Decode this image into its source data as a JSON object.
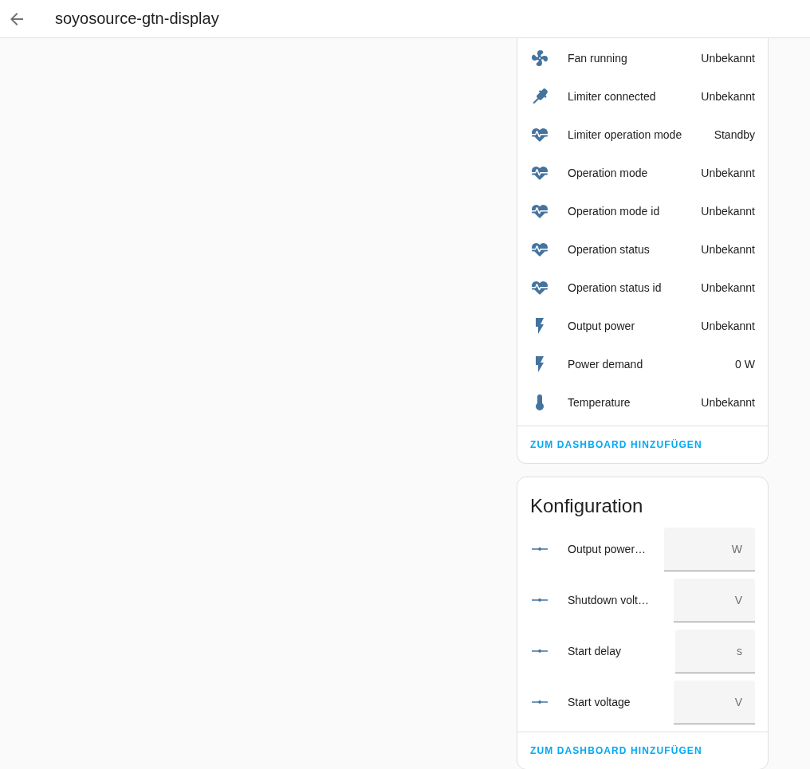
{
  "header": {
    "title": "soyosource-gtn-display"
  },
  "sensor_card": {
    "rows": [
      {
        "kind": "fan",
        "label": "Fan running",
        "value": "Unbekannt"
      },
      {
        "kind": "plug",
        "label": "Limiter connected",
        "value": "Unbekannt"
      },
      {
        "kind": "pulse",
        "label": "Limiter operation mode",
        "value": "Standby"
      },
      {
        "kind": "pulse",
        "label": "Operation mode",
        "value": "Unbekannt"
      },
      {
        "kind": "pulse",
        "label": "Operation mode id",
        "value": "Unbekannt"
      },
      {
        "kind": "pulse",
        "label": "Operation status",
        "value": "Unbekannt"
      },
      {
        "kind": "pulse",
        "label": "Operation status id",
        "value": "Unbekannt"
      },
      {
        "kind": "flash",
        "label": "Output power",
        "value": "Unbekannt"
      },
      {
        "kind": "flash",
        "label": "Power demand",
        "value": "0 W"
      },
      {
        "kind": "thermometer",
        "label": "Temperature",
        "value": "Unbekannt"
      }
    ],
    "action": "ZUM DASHBOARD HINZUFÜGEN"
  },
  "config_card": {
    "title": "Konfiguration",
    "rows": [
      {
        "label": "Output power…",
        "unit": "W"
      },
      {
        "label": "Shutdown volt…",
        "unit": "V"
      },
      {
        "label": "Start delay",
        "unit": "s"
      },
      {
        "label": "Start voltage",
        "unit": "V"
      }
    ],
    "action": "ZUM DASHBOARD HINZUFÜGEN"
  }
}
